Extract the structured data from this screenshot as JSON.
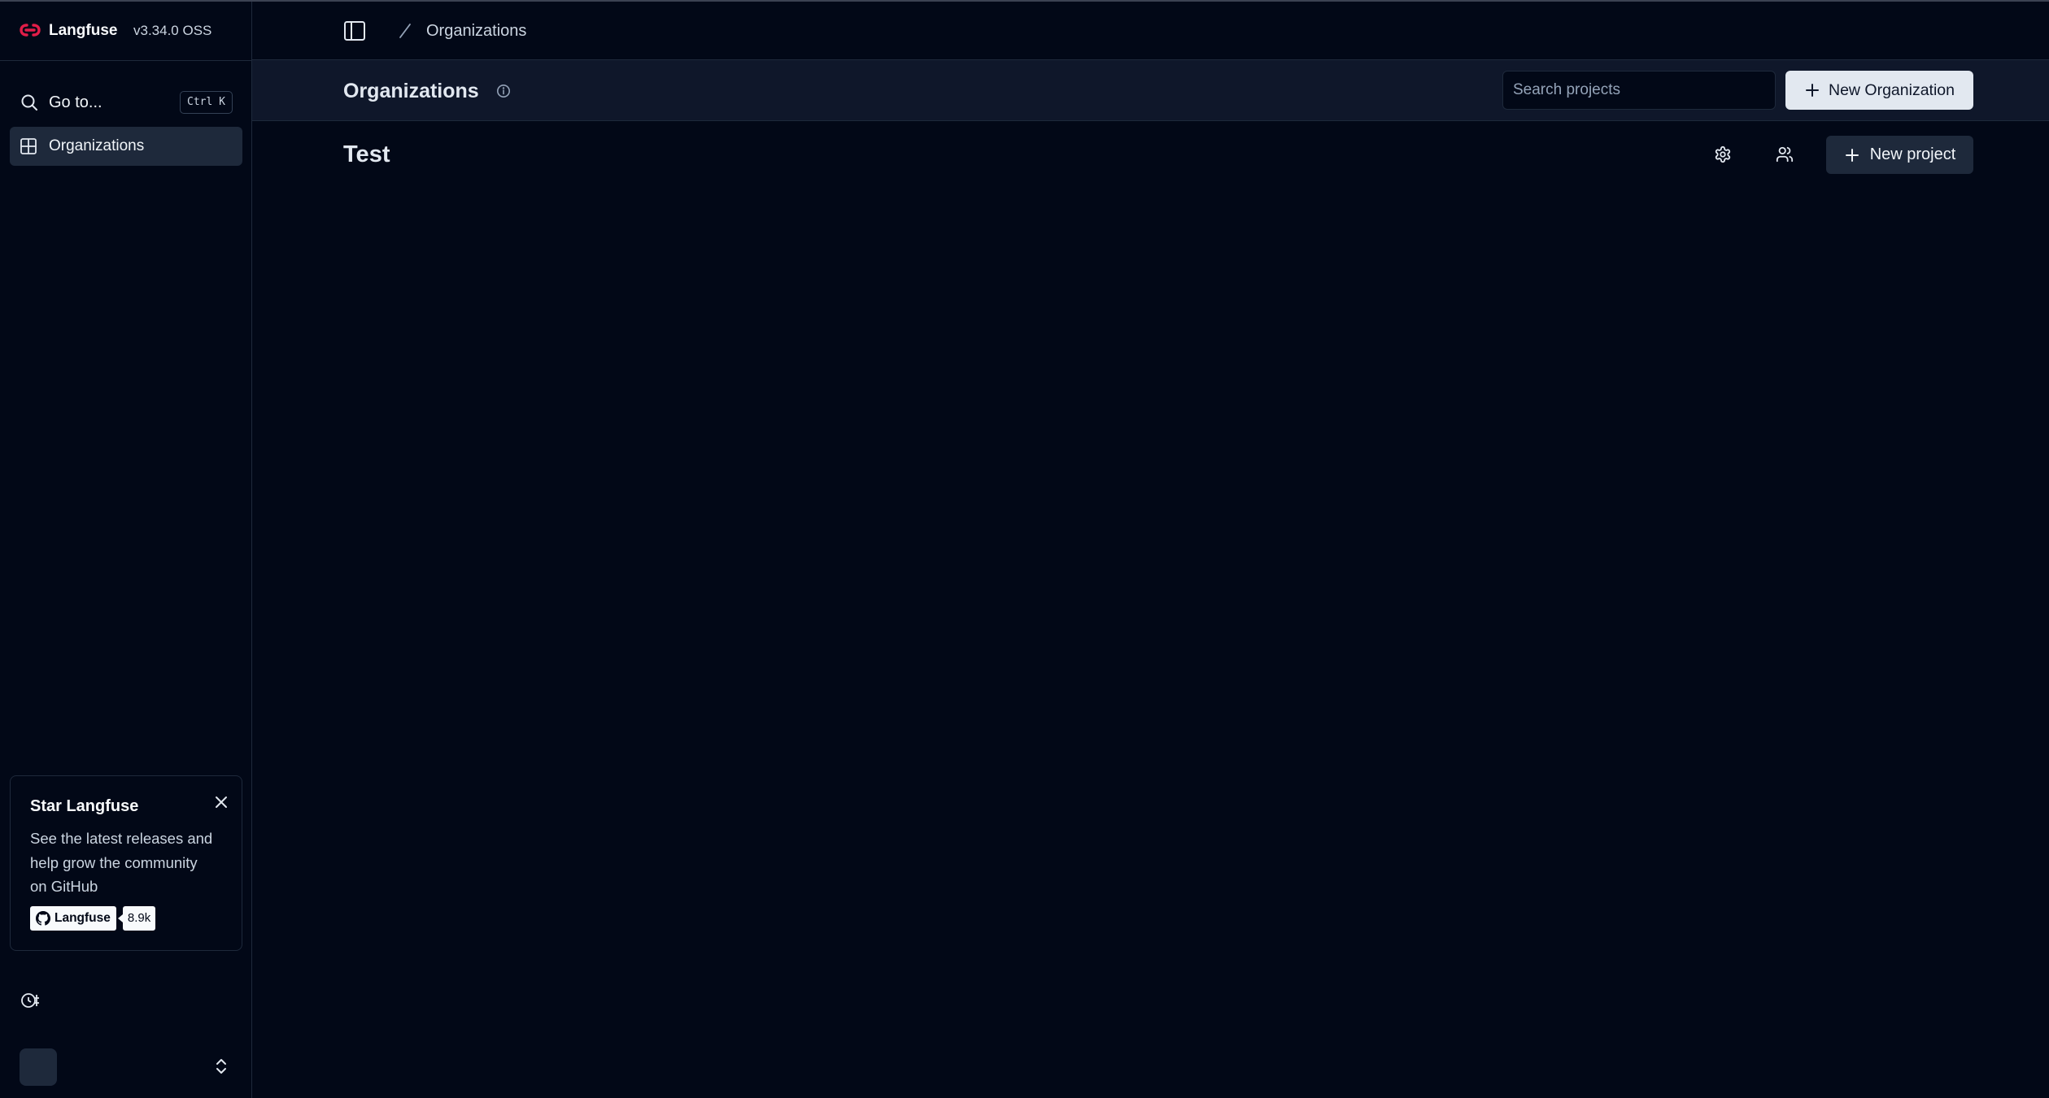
{
  "app": {
    "name": "Langfuse",
    "version": "v3.34.0 OSS"
  },
  "sidebar": {
    "goto_label": "Go to...",
    "goto_shortcut": "Ctrl K",
    "items": [
      {
        "label": "Organizations",
        "icon": "grid-icon",
        "active": true
      }
    ],
    "star_card": {
      "title": "Star Langfuse",
      "description": "See the latest releases and help grow the community on GitHub",
      "github_label": "Langfuse",
      "github_stars": "8.9k"
    },
    "environment_label": "",
    "user": {
      "avatar_initials": "",
      "name": "",
      "email": ""
    }
  },
  "header": {
    "breadcrumb": "Organizations"
  },
  "page": {
    "title": "Organizations",
    "search_placeholder": "Search projects",
    "new_org_label": "New Organization"
  },
  "organization": {
    "name": "Test",
    "new_project_label": "New project"
  },
  "colors": {
    "background": "#020817",
    "panel": "#0f172a",
    "border": "#1e293b",
    "brand_red": "#e11d48",
    "primary_button": "#e2e8f0"
  }
}
